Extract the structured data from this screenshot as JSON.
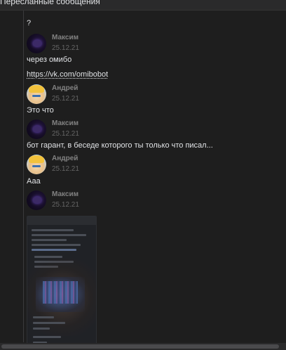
{
  "header": {
    "title": "Пересланные сообщения"
  },
  "messages": [
    {
      "type": "text",
      "text": "?"
    },
    {
      "type": "author",
      "name": "Максим",
      "date": "25.12.21",
      "avatar": "maxim-avatar"
    },
    {
      "type": "text",
      "text": "через омибо"
    },
    {
      "type": "link",
      "text": "https://vk.com/omibobot"
    },
    {
      "type": "author",
      "name": "Андрей",
      "date": "25.12.21",
      "avatar": "andrey-avatar"
    },
    {
      "type": "text",
      "text": "Это что"
    },
    {
      "type": "author",
      "name": "Максим",
      "date": "25.12.21",
      "avatar": "maxim-avatar"
    },
    {
      "type": "text",
      "text": "бот гарант, в беседе которого ты только что писал..."
    },
    {
      "type": "author",
      "name": "Андрей",
      "date": "25.12.21",
      "avatar": "andrey-avatar"
    },
    {
      "type": "text",
      "text": "Ааа"
    },
    {
      "type": "author",
      "name": "Максим",
      "date": "25.12.21",
      "avatar": "maxim-avatar"
    },
    {
      "type": "image",
      "description": "screenshot-attachment"
    }
  ],
  "colors": {
    "background": "#1e1e1e",
    "text": "#e1e3e6",
    "author_name": "#828282",
    "date": "#656565"
  }
}
